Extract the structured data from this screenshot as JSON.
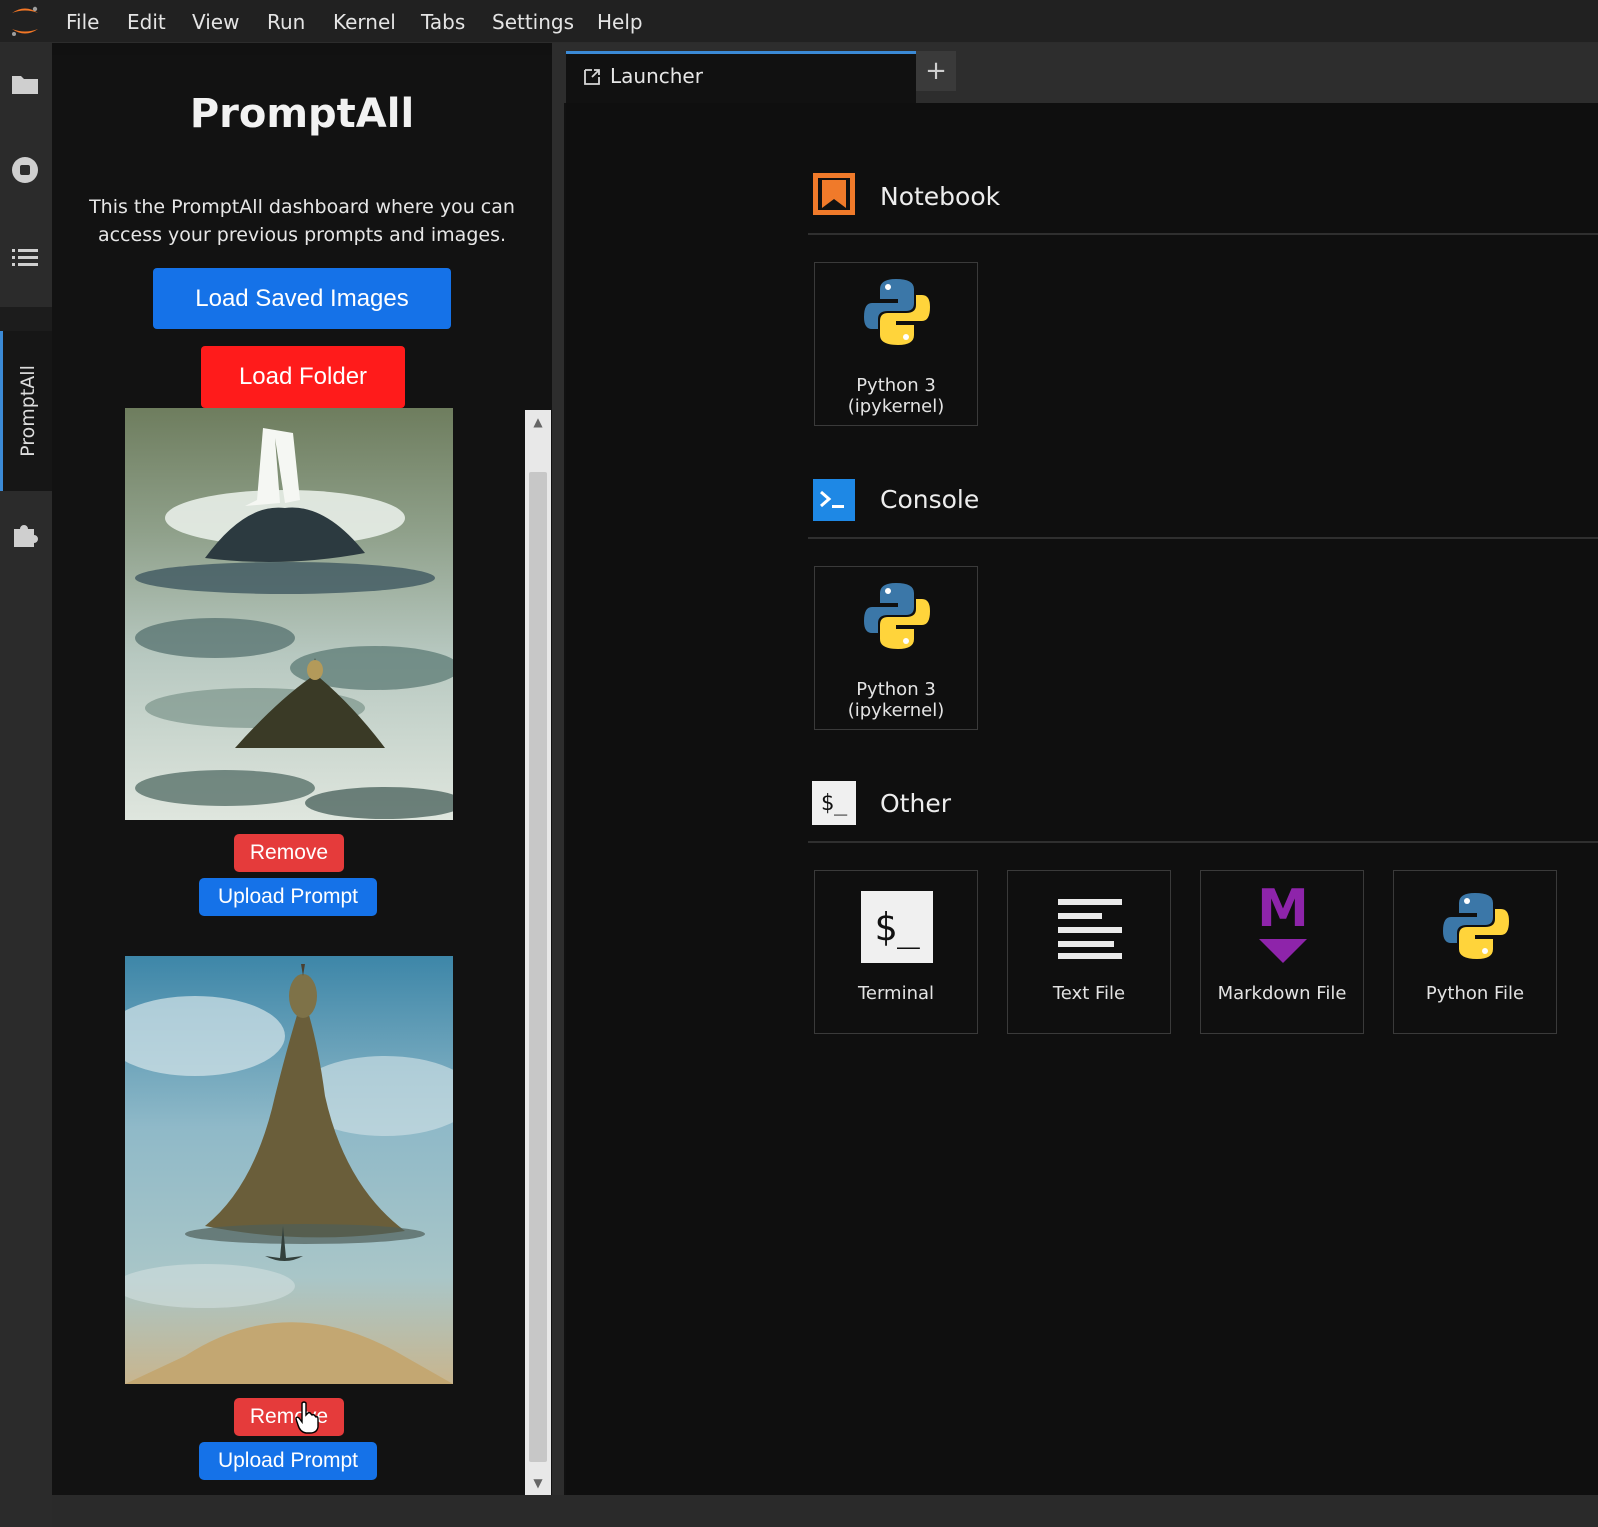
{
  "menubar": {
    "items": [
      "File",
      "Edit",
      "View",
      "Run",
      "Kernel",
      "Tabs",
      "Settings",
      "Help"
    ]
  },
  "activity_bar": {
    "icons": [
      "folder-icon",
      "running-icon",
      "toc-icon",
      "extension-icon"
    ],
    "promptall_tab": "PromptAll"
  },
  "panel": {
    "title": "PromptAll",
    "description": "This the PromptAll dashboard where you can access your previous prompts and images.",
    "load_saved_images": "Load Saved Images",
    "load_folder": "Load Folder",
    "images": [
      {
        "remove": "Remove",
        "upload": "Upload Prompt"
      },
      {
        "remove": "Remove",
        "upload": "Upload Prompt"
      }
    ]
  },
  "tabs": {
    "launcher": "Launcher",
    "add": "+"
  },
  "launcher": {
    "sections": [
      {
        "title": "Notebook",
        "cards": [
          {
            "line1": "Python 3",
            "line2": "(ipykernel)"
          }
        ]
      },
      {
        "title": "Console",
        "cards": [
          {
            "line1": "Python 3",
            "line2": "(ipykernel)"
          }
        ]
      },
      {
        "title": "Other",
        "icon_text": "$_",
        "cards": [
          {
            "label": "Terminal",
            "icon_text": "$_"
          },
          {
            "label": "Text File"
          },
          {
            "label": "Markdown File",
            "icon_text": "M"
          },
          {
            "label": "Python File"
          }
        ]
      }
    ]
  },
  "colors": {
    "accent_blue": "#1572e8",
    "load_folder_red": "#ff1b1b",
    "remove_red": "#e53b3b",
    "notebook_orange": "#f07a2a",
    "console_blue": "#1e88e5",
    "markdown_purple": "#8e24aa"
  }
}
